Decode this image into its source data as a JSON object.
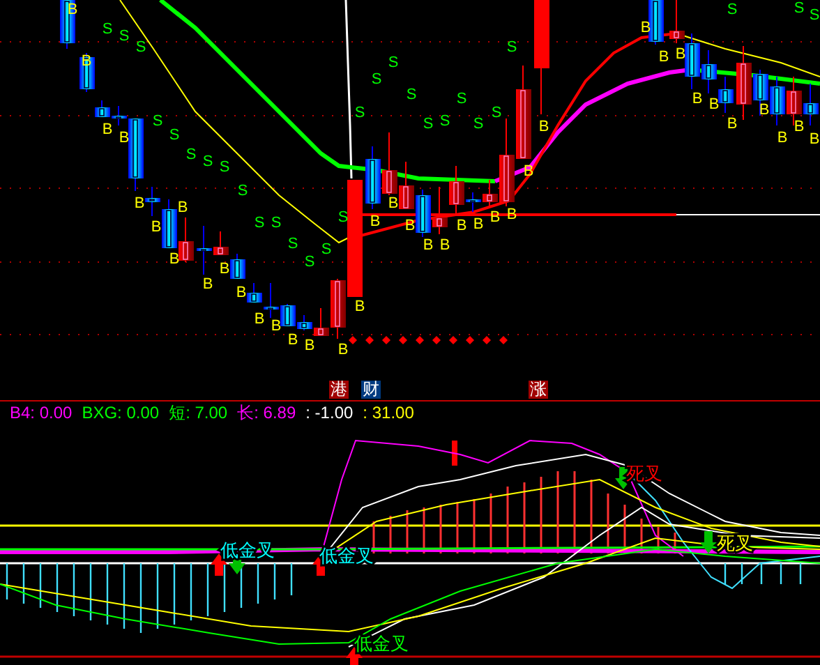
{
  "price_chart": {
    "buy_signs": [
      "B",
      "B",
      "B",
      "B",
      "B",
      "B",
      "B",
      "B",
      "B",
      "B",
      "B",
      "B",
      "B",
      "B",
      "B",
      "B",
      "B",
      "B",
      "B",
      "B",
      "B",
      "B",
      "B",
      "B",
      "B",
      "B",
      "B",
      "B",
      "B",
      "B",
      "B",
      "B",
      "B",
      "B",
      "B",
      "B",
      "B",
      "B"
    ],
    "sell_signs": [
      "S",
      "S",
      "S",
      "S",
      "S",
      "S",
      "S",
      "S",
      "S",
      "S",
      "S",
      "S",
      "S",
      "S",
      "S",
      "S",
      "S",
      "S",
      "S",
      "S",
      "S",
      "S",
      "S",
      "S",
      "S",
      "S",
      "S",
      "S"
    ]
  },
  "tags": [
    {
      "text": "港",
      "color": "#a00000"
    },
    {
      "text": "财",
      "color": "#003a80"
    },
    {
      "text": "涨",
      "color": "#a00000"
    }
  ],
  "indicator_values": [
    {
      "text": "B4: 0.00",
      "color": "#ff00ff"
    },
    {
      "text": "BXG: 0.00",
      "color": "#00ff00"
    },
    {
      "text": "短: 7.00",
      "color": "#00ff00"
    },
    {
      "text": "长: 6.89",
      "color": "#ff00ff"
    },
    {
      "text": ": -1.00",
      "color": "#ffffff"
    },
    {
      "text": ": 31.00",
      "color": "#ffff00"
    }
  ],
  "signals": [
    {
      "text": "低金叉",
      "color": "#00ffff"
    },
    {
      "text": "低金叉",
      "color": "#00ffff"
    },
    {
      "text": "低金叉",
      "color": "#00ff00"
    },
    {
      "text": "死叉",
      "color": "#ff0000"
    },
    {
      "text": "死叉",
      "color": "#ffff00"
    }
  ]
}
